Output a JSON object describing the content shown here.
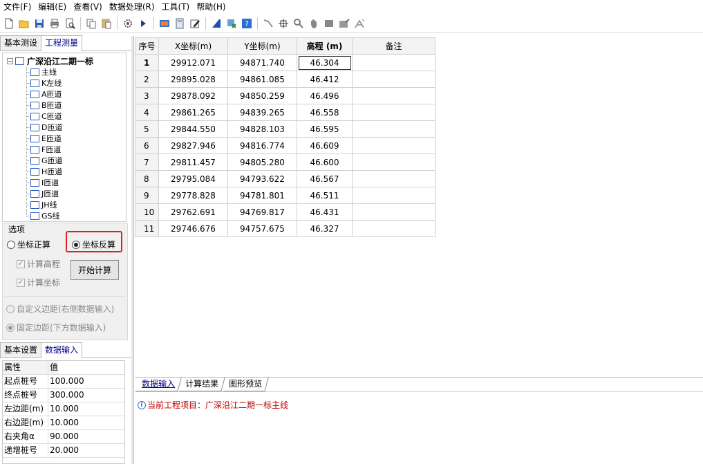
{
  "menu": [
    "文件(F)",
    "编辑(E)",
    "查看(V)",
    "数据处理(R)",
    "工具(T)",
    "帮助(H)"
  ],
  "toolbar": {
    "icons": [
      "new-file-icon",
      "open-folder-icon",
      "save-icon",
      "print-icon",
      "print-preview-icon",
      "copy-icon",
      "paste-icon",
      "settings-gear-icon",
      "run-play-icon",
      "image-export-icon",
      "calculator-icon",
      "edit-icon",
      "road-design-icon",
      "grid-tool-icon",
      "help-icon",
      "line-tool-icon",
      "crosshair-icon",
      "zoom-icon",
      "pan-hand-icon",
      "rectangle-tool-icon",
      "image-tool-icon",
      "measure-tool-icon"
    ]
  },
  "left_tabs": [
    "基本测设",
    "工程测量"
  ],
  "tree": {
    "root": "广深沿江二期一标",
    "children": [
      "主线",
      "K左线",
      "A匝道",
      "B匝道",
      "C匝道",
      "D匝道",
      "E匝道",
      "F匝道",
      "G匝道",
      "H匝道",
      "I匝道",
      "J匝道",
      "JH线",
      "GS线"
    ]
  },
  "options": {
    "title": "选项",
    "forward": "坐标正算",
    "inverse": "坐标反算",
    "calc_elevation": "计算高程",
    "calc_coord": "计算坐标",
    "start": "开始计算",
    "custom_margin": "自定义边距(右侧数据输入)",
    "fixed_margin": "固定边距(下方数据输入)"
  },
  "bottom_left_tabs": [
    "基本设置",
    "数据输入"
  ],
  "props": {
    "header": [
      "属性",
      "值"
    ],
    "rows": [
      [
        "起点桩号",
        "100.000"
      ],
      [
        "终点桩号",
        "300.000"
      ],
      [
        "左边距(m)",
        "10.000"
      ],
      [
        "右边距(m)",
        "10.000"
      ],
      [
        "右夹角α",
        "90.000"
      ],
      [
        "递增桩号",
        "20.000"
      ]
    ]
  },
  "grid": {
    "headers": [
      "序号",
      "X坐标(m)",
      "Y坐标(m)",
      "高程 (m)",
      "备注"
    ],
    "rows": [
      [
        "1",
        "29912.071",
        "94871.740",
        "46.304",
        ""
      ],
      [
        "2",
        "29895.028",
        "94861.085",
        "46.412",
        ""
      ],
      [
        "3",
        "29878.092",
        "94850.259",
        "46.496",
        ""
      ],
      [
        "4",
        "29861.265",
        "94839.265",
        "46.558",
        ""
      ],
      [
        "5",
        "29844.550",
        "94828.103",
        "46.595",
        ""
      ],
      [
        "6",
        "29827.946",
        "94816.774",
        "46.609",
        ""
      ],
      [
        "7",
        "29811.457",
        "94805.280",
        "46.600",
        ""
      ],
      [
        "8",
        "29795.084",
        "94793.622",
        "46.567",
        ""
      ],
      [
        "9",
        "29778.828",
        "94781.801",
        "46.511",
        ""
      ],
      [
        "10",
        "29762.691",
        "94769.817",
        "46.431",
        ""
      ],
      [
        "11",
        "29746.676",
        "94757.675",
        "46.327",
        ""
      ]
    ]
  },
  "bottom_tabs": [
    "数据输入",
    "计算结果",
    "图形预览"
  ],
  "message": "当前工程项目：广深沿江二期一标主线",
  "colors": {
    "accent": "#00008b",
    "highlight": "#e02020",
    "message": "#c00000"
  }
}
